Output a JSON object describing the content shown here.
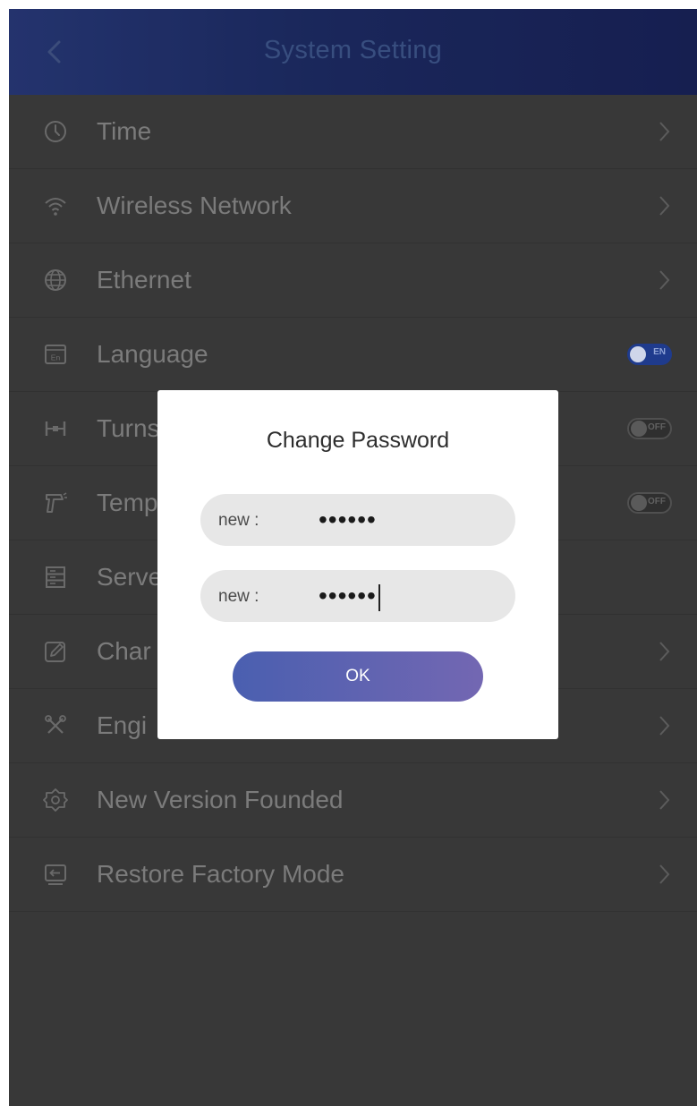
{
  "header": {
    "title": "System Setting",
    "back_icon": "chevron-left-icon"
  },
  "settings": {
    "items": [
      {
        "label": "Time",
        "icon": "clock-icon",
        "control": "chevron"
      },
      {
        "label": "Wireless Network",
        "icon": "wifi-icon",
        "control": "chevron"
      },
      {
        "label": "Ethernet",
        "icon": "globe-icon",
        "control": "chevron"
      },
      {
        "label": "Language",
        "icon": "language-icon",
        "control": "toggle",
        "toggle_state": "on",
        "toggle_text": "EN"
      },
      {
        "label": "Turnstile",
        "visible_label": "Turns",
        "icon": "turnstile-icon",
        "control": "toggle",
        "toggle_state": "off",
        "toggle_text": "OFF"
      },
      {
        "label": "Temperature",
        "visible_label": "Temp",
        "icon": "thermometer-icon",
        "control": "toggle",
        "toggle_state": "off",
        "toggle_text": "OFF"
      },
      {
        "label": "Server",
        "visible_label": "Serve",
        "icon": "server-icon",
        "control": "none"
      },
      {
        "label": "Change Password",
        "visible_label": "Char",
        "icon": "edit-icon",
        "control": "chevron"
      },
      {
        "label": "Engineering Mode",
        "visible_label": "Engi",
        "icon": "tools-icon",
        "control": "chevron"
      },
      {
        "label": "New Version Founded",
        "icon": "gear-icon",
        "control": "chevron"
      },
      {
        "label": "Restore Factory Mode",
        "icon": "restore-icon",
        "control": "chevron"
      }
    ]
  },
  "dialog": {
    "title": "Change Password",
    "fields": [
      {
        "label": "new :",
        "value": "••••••"
      },
      {
        "label": "new :",
        "value": "••••••"
      }
    ],
    "ok_label": "OK"
  },
  "colors": {
    "header_start": "#2c3f86",
    "header_end": "#1c2662",
    "overlay_background": "#383838",
    "toggle_on": "#1f3b8d",
    "ok_button_start": "#4a5fb0",
    "ok_button_end": "#7367b2"
  }
}
